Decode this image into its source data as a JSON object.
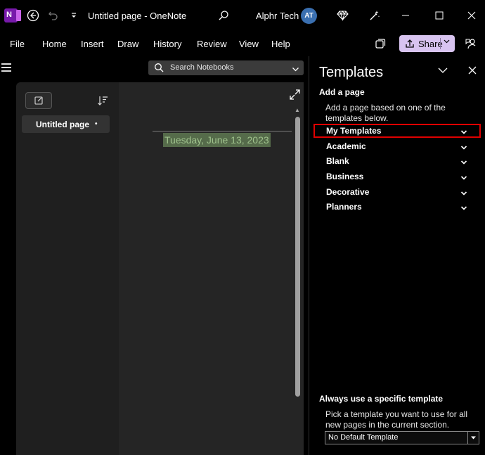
{
  "window": {
    "app_logo_letter": "N",
    "title": "Untitled page  -  OneNote",
    "user_name": "Alphr Tech",
    "user_initials": "AT"
  },
  "ribbon": {
    "menu": [
      "File",
      "Home",
      "Insert",
      "Draw",
      "History",
      "Review",
      "View",
      "Help"
    ],
    "share_label": "Share"
  },
  "search": {
    "placeholder": "Search Notebooks"
  },
  "pages": {
    "items": [
      {
        "label": "Untitled page",
        "marker": "•"
      }
    ]
  },
  "page": {
    "date": "Tuesday, June 13, 2023"
  },
  "templates_pane": {
    "title": "Templates",
    "add_page_heading": "Add a page",
    "add_page_desc": "Add a page based on one of the templates below.",
    "categories": [
      "My Templates",
      "Academic",
      "Blank",
      "Business",
      "Decorative",
      "Planners"
    ],
    "highlighted_category": "My Templates",
    "default_heading": "Always use a specific template",
    "default_desc": "Pick a template you want to use for all new pages in the current section.",
    "default_value": "No Default Template"
  },
  "colors": {
    "background": "#000000",
    "share_button": "#d8c4f0",
    "onenote_purple": "#7719aa",
    "highlight_box": "#e00000",
    "date_highlight": "#556b4a"
  }
}
